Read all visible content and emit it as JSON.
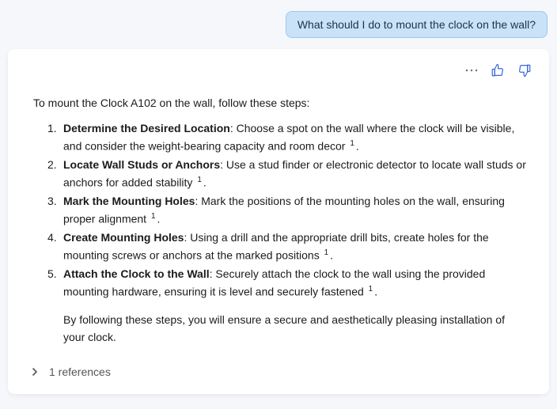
{
  "user_message": "What should I do to mount the clock on the wall?",
  "intro": "To mount the Clock A102 on the wall, follow these steps:",
  "steps": [
    {
      "title": "Determine the Desired Location",
      "body": ": Choose a spot on the wall where the clock will be visible, and consider the weight-bearing capacity and room decor",
      "ref": "1"
    },
    {
      "title": "Locate Wall Studs or Anchors",
      "body": ": Use a stud finder or electronic detector to locate wall studs or anchors for added stability",
      "ref": "1"
    },
    {
      "title": "Mark the Mounting Holes",
      "body": ": Mark the positions of the mounting holes on the wall, ensuring proper alignment",
      "ref": "1"
    },
    {
      "title": "Create Mounting Holes",
      "body": ": Using a drill and the appropriate drill bits, create holes for the mounting screws or anchors at the marked positions",
      "ref": "1"
    },
    {
      "title": "Attach the Clock to the Wall",
      "body": ": Securely attach the clock to the wall using the provided mounting hardware, ensuring it is level and securely fastened",
      "ref": "1"
    }
  ],
  "closing": "By following these steps, you will ensure a secure and aesthetically pleasing installation of your clock.",
  "references_label": "1 references"
}
